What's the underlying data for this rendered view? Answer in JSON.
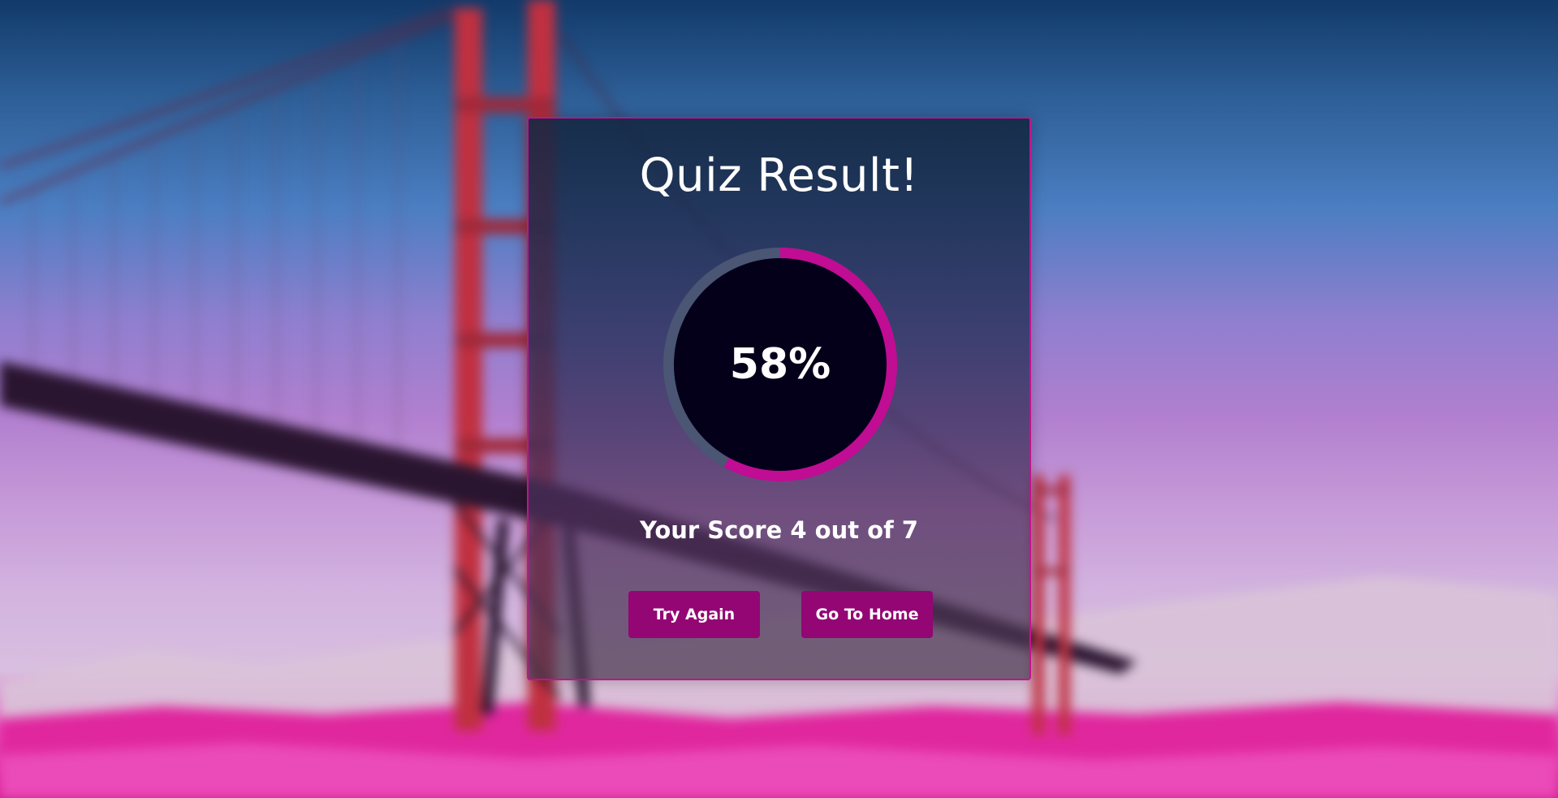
{
  "quiz_result": {
    "title": "Quiz Result!",
    "percent_label": "58%",
    "percent_value": 58,
    "score_text": "Your Score 4 out of 7",
    "buttons": {
      "try_again": "Try Again",
      "go_home": "Go To Home"
    }
  },
  "colors": {
    "accent": "#c10c94",
    "button_bg": "#930674",
    "ring_track": "#4a5673",
    "ring_center": "#05001a",
    "card_border": "#c0148f"
  }
}
